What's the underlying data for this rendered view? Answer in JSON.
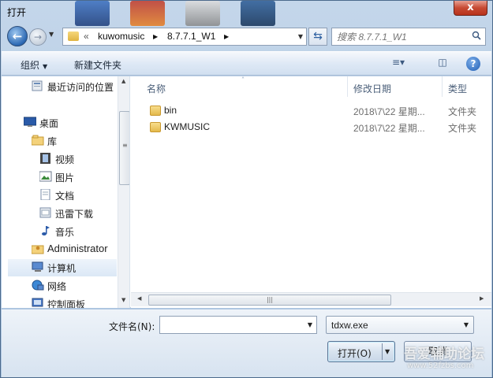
{
  "window": {
    "title": "打开",
    "close": "x"
  },
  "nav": {
    "back": "←",
    "forward": "→",
    "breadcrumb_prefix": "«",
    "crumbs": [
      "kuwomusic",
      "8.7.7.1_W1"
    ],
    "search_placeholder": "搜索 8.7.7.1_W1"
  },
  "toolbar": {
    "organize": "组织",
    "new_folder": "新建文件夹",
    "help": "?"
  },
  "sidebar": {
    "items": [
      {
        "label": "最近访问的位置",
        "icon": "recent-places-icon"
      },
      {
        "label": "桌面",
        "icon": "desktop-icon"
      },
      {
        "label": "库",
        "icon": "libraries-icon"
      },
      {
        "label": "视频",
        "icon": "video-icon"
      },
      {
        "label": "图片",
        "icon": "pictures-icon"
      },
      {
        "label": "文档",
        "icon": "documents-icon"
      },
      {
        "label": "迅雷下载",
        "icon": "thunder-download-icon"
      },
      {
        "label": "音乐",
        "icon": "music-icon"
      },
      {
        "label": "Administrator",
        "icon": "user-folder-icon"
      },
      {
        "label": "计算机",
        "icon": "computer-icon"
      },
      {
        "label": "网络",
        "icon": "network-icon"
      },
      {
        "label": "控制面板",
        "icon": "control-panel-icon"
      }
    ]
  },
  "filelist": {
    "columns": {
      "name": "名称",
      "modified": "修改日期",
      "type": "类型"
    },
    "rows": [
      {
        "name": "bin",
        "modified": "2018\\7\\22 星期...",
        "type": "文件夹"
      },
      {
        "name": "KWMUSIC",
        "modified": "2018\\7\\22 星期...",
        "type": "文件夹"
      }
    ]
  },
  "bottom": {
    "filename_label": "文件名(N):",
    "filename_value": "",
    "filter_value": "tdxw.exe",
    "open_label": "打开(O)",
    "cancel_label": "取消"
  },
  "watermark": {
    "text": "吾爱辅助论坛",
    "url": "www.52fzbs.com"
  },
  "colors": {
    "accent": "#2c68b3",
    "folder": "#e3b94c",
    "close": "#c74a33"
  }
}
